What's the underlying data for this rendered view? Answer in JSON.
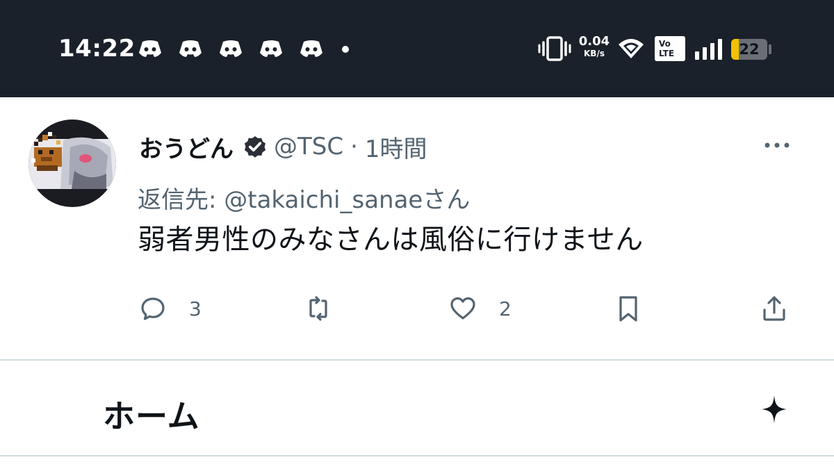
{
  "status_bar": {
    "time": "14:22",
    "notification_icons": [
      "discord-icon",
      "discord-icon",
      "discord-icon",
      "discord-icon",
      "discord-icon"
    ],
    "network_speed_value": "0.04",
    "network_speed_unit": "KB/s",
    "volte_top": "Vo",
    "volte_bottom": "LTE",
    "battery_level": "22",
    "background_color": "#1a212a",
    "battery_color": "#f2c200"
  },
  "tweet": {
    "display_name": "おうどん",
    "handle": "@TSC",
    "separator": "·",
    "timestamp": "1時間",
    "reply_prefix": "返信先: ",
    "reply_mention": "@takaichi_sanae",
    "reply_suffix": "さん",
    "text": "弱者男性のみなさんは風俗に行けません",
    "reply_count": "3",
    "like_count": "2",
    "text_color": "#0f1419",
    "secondary_color": "#536471"
  },
  "home": {
    "title": "ホーム"
  }
}
